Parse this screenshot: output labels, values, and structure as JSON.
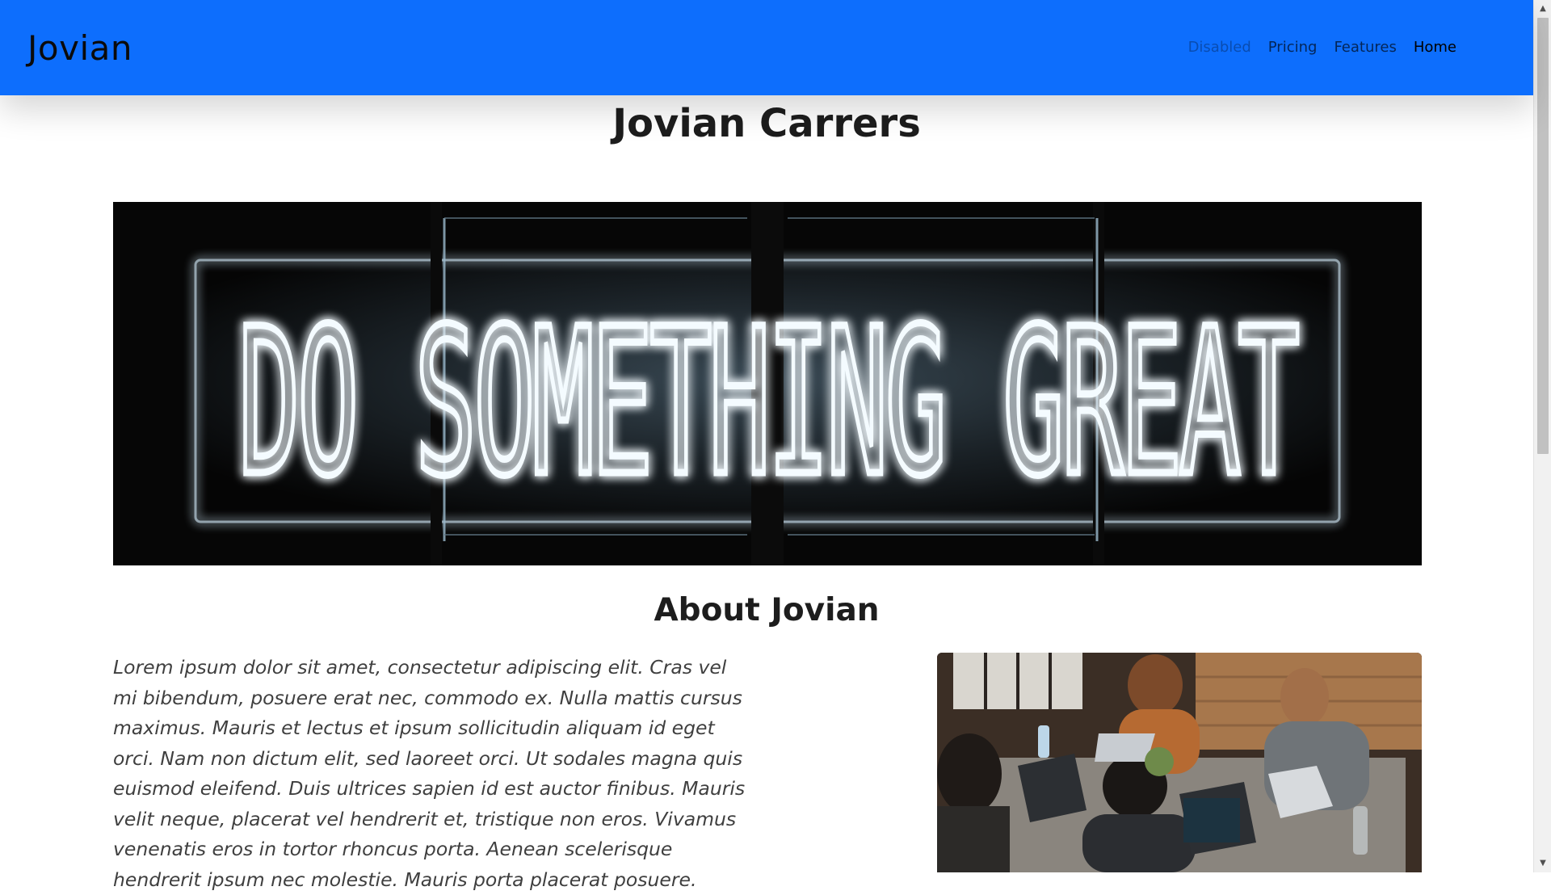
{
  "navbar": {
    "brand": "Jovian",
    "links": [
      {
        "label": "Disabled",
        "state": "disabled"
      },
      {
        "label": "Pricing",
        "state": "normal"
      },
      {
        "label": "Features",
        "state": "normal"
      },
      {
        "label": "Home",
        "state": "active"
      }
    ],
    "background": "#0d6efd"
  },
  "main": {
    "title": "Jovian Carrers",
    "hero_image": {
      "sign_text": "DO SOMETHING GREAT"
    },
    "about": {
      "heading": "About Jovian",
      "paragraph": "Lorem ipsum dolor sit amet, consectetur adipiscing elit. Cras vel mi bibendum, posuere erat nec, commodo ex. Nulla mattis cursus maximus. Mauris et lectus et ipsum sollicitudin aliquam id eget orci. Nam non dictum elit, sed laoreet orci. Ut sodales magna quis euismod eleifend. Duis ultrices sapien id est auctor finibus. Mauris velit neque, placerat vel hendrerit et, tristique non eros. Vivamus venenatis eros in tortor rhoncus porta. Aenean scelerisque hendrerit ipsum nec molestie. Mauris porta placerat posuere."
    }
  }
}
